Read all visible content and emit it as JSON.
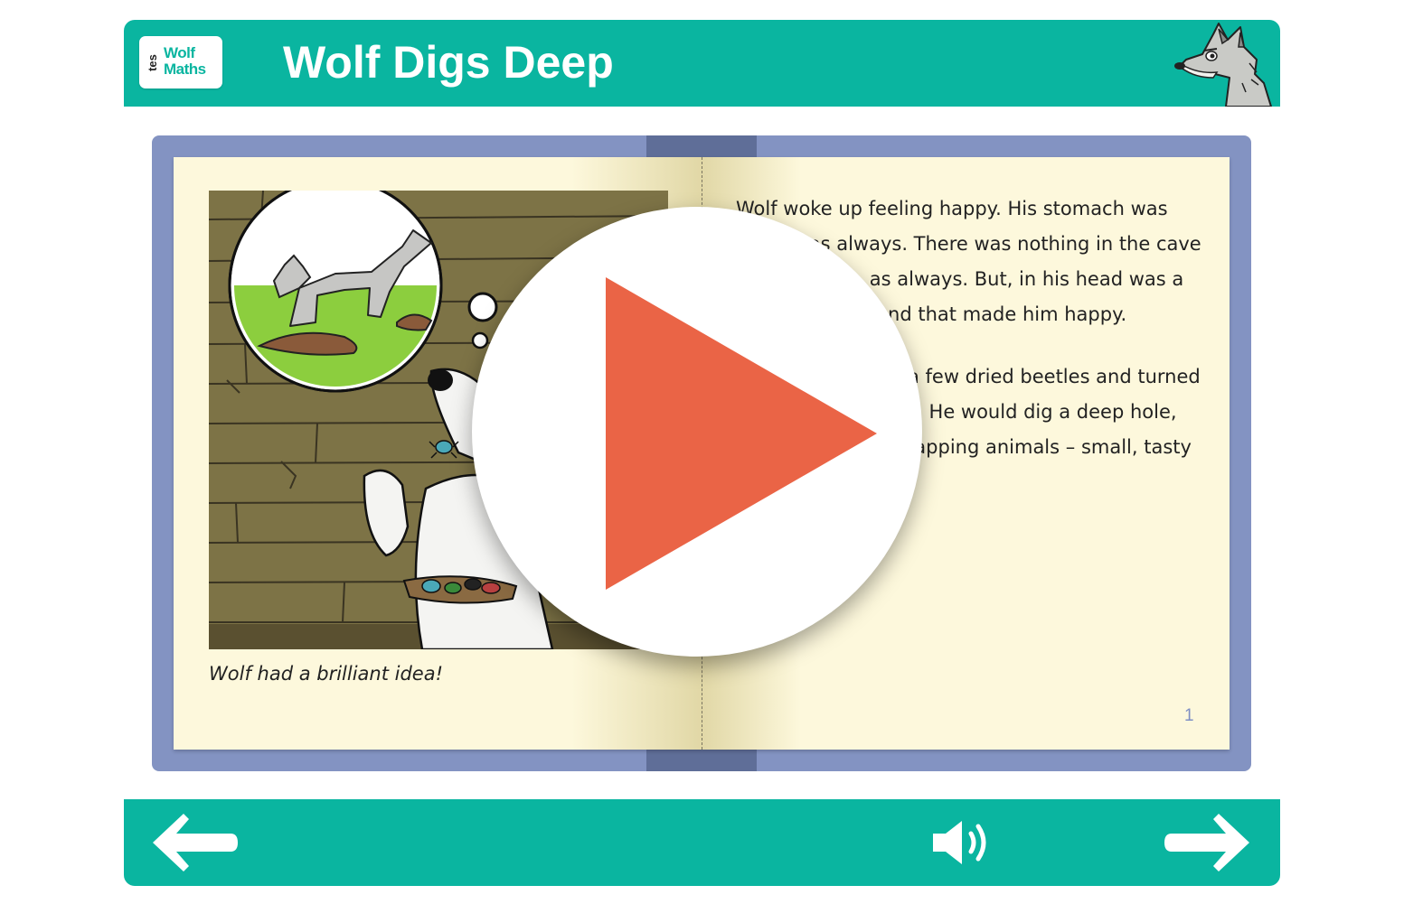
{
  "header": {
    "logo": {
      "tes": "tes",
      "line1": "Wolf",
      "line2": "Maths"
    },
    "title": "Wolf Digs Deep",
    "mascot_icon": "wolf-head-icon"
  },
  "book": {
    "left_page": {
      "illustration_icon": "wolf-with-beetles-illustration",
      "caption": "Wolf had a brilliant idea!"
    },
    "right_page": {
      "paragraphs": [
        "Wolf woke up feeling happy. His stomach was empty, as always. There was nothing in the cave for breakfast, as always. But, in his head was a brilliant idea – and that made him happy.",
        "Wolf munched on a few dried beetles and turned his idea into a plan. He would dig a deep hole, deep enough for trapping animals – small, tasty animals."
      ],
      "page_number": "1"
    }
  },
  "overlay": {
    "play_icon": "play-icon",
    "play_color": "#ea6446"
  },
  "footer": {
    "back_icon": "arrow-left-icon",
    "audio_icon": "speaker-icon",
    "forward_icon": "arrow-right-icon"
  },
  "colors": {
    "brand": "#0ab5a0",
    "book_cover": "#8393c2",
    "paper": "#fdf8dc",
    "page_number": "#7f8fc4"
  }
}
